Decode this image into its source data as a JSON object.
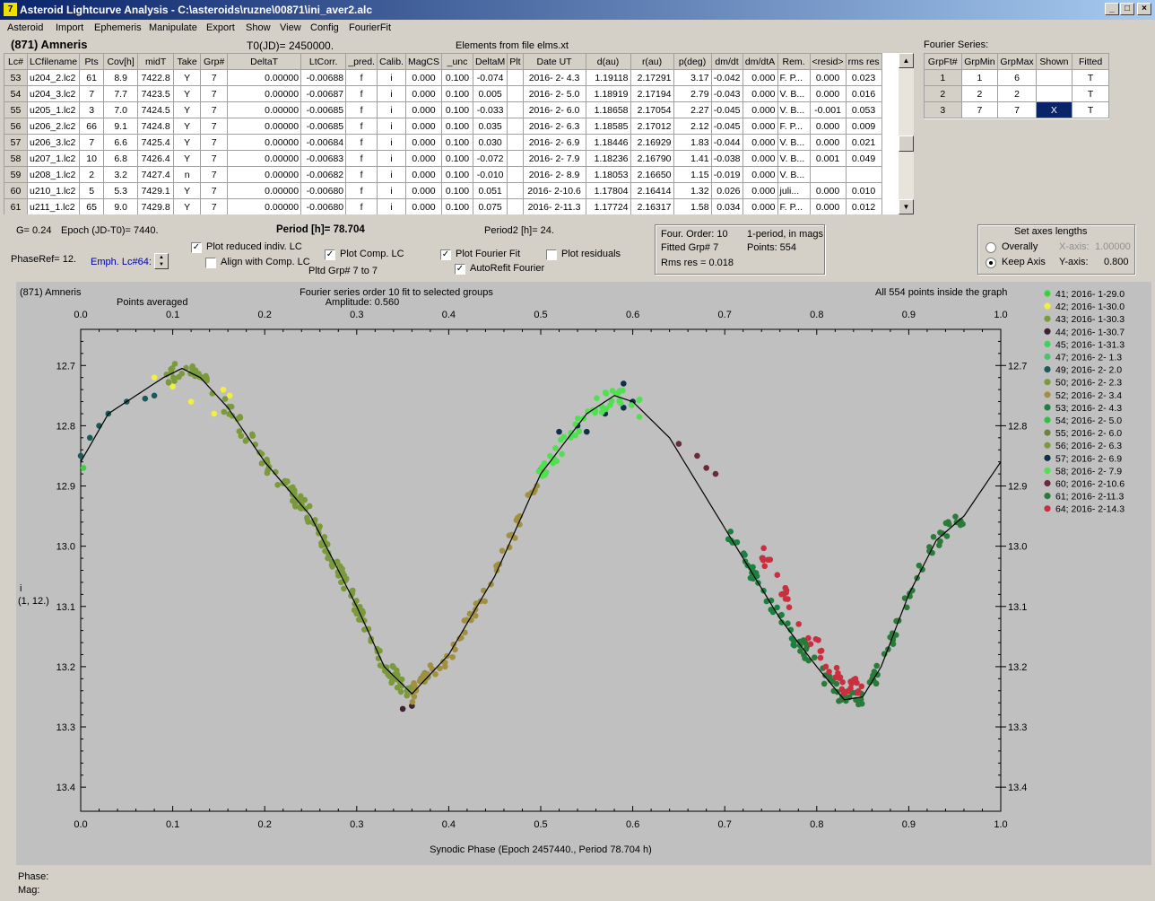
{
  "window": {
    "title": "Asteroid Lightcurve Analysis - C:\\asteroids\\ruzne\\00871\\ini_aver2.alc",
    "min": "_",
    "max": "□",
    "close": "×"
  },
  "menu": [
    "Asteroid",
    "Import",
    "Ephemeris",
    "Manipulate",
    "Export",
    "Show",
    "View",
    "Config",
    "FourierFit"
  ],
  "header": {
    "asteroid": "(871) Amneris",
    "t0": "T0(JD)= 2450000.",
    "elements": "Elements from file elms.xt",
    "fourier_title": "Fourier Series:"
  },
  "table": {
    "columns": [
      "Lc#",
      "LCfilename",
      "Pts",
      "Cov[h]",
      "midT",
      "Take",
      "Grp#",
      "DeltaT",
      "LtCorr.",
      "_pred.",
      "Calib.",
      "MagCS",
      "_unc",
      "DeltaM",
      "Plt",
      "Date UT",
      "d(au)",
      "r(au)",
      "p(deg)",
      "dm/dt",
      "dm/dtA",
      "Rem.",
      "<resid>",
      "rms res"
    ],
    "rows": [
      [
        "53",
        "u204_2.lc2",
        "61",
        "8.9",
        "7422.8",
        "Y",
        "7",
        "0.00000",
        "-0.00688",
        "f",
        "i",
        "0.000",
        "0.100",
        "-0.074",
        "",
        "2016- 2- 4.3",
        "1.19118",
        "2.17291",
        "3.17",
        "-0.042",
        "0.000",
        "F. P...",
        "0.000",
        "0.023"
      ],
      [
        "54",
        "u204_3.lc2",
        "7",
        "7.7",
        "7423.5",
        "Y",
        "7",
        "0.00000",
        "-0.00687",
        "f",
        "i",
        "0.000",
        "0.100",
        "0.005",
        "",
        "2016- 2- 5.0",
        "1.18919",
        "2.17194",
        "2.79",
        "-0.043",
        "0.000",
        "V. B...",
        "0.000",
        "0.016"
      ],
      [
        "55",
        "u205_1.lc2",
        "3",
        "7.0",
        "7424.5",
        "Y",
        "7",
        "0.00000",
        "-0.00685",
        "f",
        "i",
        "0.000",
        "0.100",
        "-0.033",
        "",
        "2016- 2- 6.0",
        "1.18658",
        "2.17054",
        "2.27",
        "-0.045",
        "0.000",
        "V. B...",
        "-0.001",
        "0.053"
      ],
      [
        "56",
        "u206_2.lc2",
        "66",
        "9.1",
        "7424.8",
        "Y",
        "7",
        "0.00000",
        "-0.00685",
        "f",
        "i",
        "0.000",
        "0.100",
        "0.035",
        "",
        "2016- 2- 6.3",
        "1.18585",
        "2.17012",
        "2.12",
        "-0.045",
        "0.000",
        "F. P...",
        "0.000",
        "0.009"
      ],
      [
        "57",
        "u206_3.lc2",
        "7",
        "6.6",
        "7425.4",
        "Y",
        "7",
        "0.00000",
        "-0.00684",
        "f",
        "i",
        "0.000",
        "0.100",
        "0.030",
        "",
        "2016- 2- 6.9",
        "1.18446",
        "2.16929",
        "1.83",
        "-0.044",
        "0.000",
        "V. B...",
        "0.000",
        "0.021"
      ],
      [
        "58",
        "u207_1.lc2",
        "10",
        "6.8",
        "7426.4",
        "Y",
        "7",
        "0.00000",
        "-0.00683",
        "f",
        "i",
        "0.000",
        "0.100",
        "-0.072",
        "",
        "2016- 2- 7.9",
        "1.18236",
        "2.16790",
        "1.41",
        "-0.038",
        "0.000",
        "V. B...",
        "0.001",
        "0.049"
      ],
      [
        "59",
        "u208_1.lc2",
        "2",
        "3.2",
        "7427.4",
        "n",
        "7",
        "0.00000",
        "-0.00682",
        "f",
        "i",
        "0.000",
        "0.100",
        "-0.010",
        "",
        "2016- 2- 8.9",
        "1.18053",
        "2.16650",
        "1.15",
        "-0.019",
        "0.000",
        "V. B...",
        "",
        ""
      ],
      [
        "60",
        "u210_1.lc2",
        "5",
        "5.3",
        "7429.1",
        "Y",
        "7",
        "0.00000",
        "-0.00680",
        "f",
        "i",
        "0.000",
        "0.100",
        "0.051",
        "",
        "2016- 2-10.6",
        "1.17804",
        "2.16414",
        "1.32",
        "0.026",
        "0.000",
        "juli...",
        "0.000",
        "0.010"
      ],
      [
        "61",
        "u211_1.lc2",
        "65",
        "9.0",
        "7429.8",
        "Y",
        "7",
        "0.00000",
        "-0.00680",
        "f",
        "i",
        "0.000",
        "0.100",
        "0.075",
        "",
        "2016- 2-11.3",
        "1.17724",
        "2.16317",
        "1.58",
        "0.034",
        "0.000",
        "F. P...",
        "0.000",
        "0.012"
      ]
    ]
  },
  "fourier_table": {
    "columns": [
      "GrpFt#",
      "GrpMin",
      "GrpMax",
      "Shown",
      "Fitted"
    ],
    "rows": [
      [
        "1",
        "1",
        "6",
        "",
        "T"
      ],
      [
        "2",
        "2",
        "2",
        "",
        "T"
      ],
      [
        "3",
        "7",
        "7",
        "X",
        "T"
      ]
    ]
  },
  "controls": {
    "g": "G= 0.24",
    "epoch": "Epoch (JD-T0)= 7440.",
    "period": "Period [h]= 78.704",
    "period2": "Period2 [h]= 24.",
    "phaseref": "PhaseRef= 12.",
    "emph": "Emph. Lc#64:",
    "plot_reduced": "Plot reduced indiv. LC",
    "align": "Align with Comp. LC",
    "plot_comp": "Plot Comp. LC",
    "pltd_grp": "Pltd Grp#  7   to   7",
    "plot_fourier": "Plot Fourier Fit",
    "autorefit": "AutoRefit Fourier",
    "plot_resid": "Plot residuals",
    "four_order": "Four. Order: 10",
    "one_period": "1-period, in mags",
    "fitted_grp": "Fitted Grp# 7",
    "points": "Points: 554",
    "rms": "Rms res      = 0.018",
    "axes_title": "Set axes lengths",
    "overally": "Overally",
    "keep_axis": "Keep Axis",
    "xaxis_lbl": "X-axis:",
    "xaxis_val": "1.00000",
    "yaxis_lbl": "Y-axis:",
    "yaxis_val": "0.800"
  },
  "plot": {
    "name": "(871) Amneris",
    "averaged": "Points averaged",
    "subtitle": "Fourier series order 10 fit to selected groups",
    "amplitude": "Amplitude: 0.560",
    "inside": "All 554 points inside the graph",
    "ylabel": "i",
    "ylabel2": "(1, 12.)",
    "xlabel": "Synodic Phase (Epoch 2457440., Period 78.704 h)"
  },
  "status": {
    "phase": "Phase:",
    "mag": "Mag:"
  },
  "chart_data": {
    "type": "scatter",
    "xlim": [
      0,
      1
    ],
    "ylim": [
      12.64,
      13.44
    ],
    "y_inverted": true,
    "xticks": [
      "0.0",
      "0.1",
      "0.2",
      "0.3",
      "0.4",
      "0.5",
      "0.6",
      "0.7",
      "0.8",
      "0.9",
      "1.0"
    ],
    "yticks": [
      "12.7",
      "12.8",
      "12.9",
      "13.0",
      "13.1",
      "13.2",
      "13.3",
      "13.4"
    ],
    "fourier_fit": {
      "x": [
        0,
        0.03,
        0.06,
        0.09,
        0.11,
        0.13,
        0.16,
        0.2,
        0.25,
        0.3,
        0.33,
        0.36,
        0.4,
        0.45,
        0.5,
        0.55,
        0.58,
        0.6,
        0.64,
        0.68,
        0.72,
        0.76,
        0.8,
        0.83,
        0.85,
        0.87,
        0.9,
        0.93,
        0.96,
        1.0
      ],
      "y": [
        12.86,
        12.78,
        12.75,
        12.72,
        12.705,
        12.72,
        12.77,
        12.86,
        12.95,
        13.1,
        13.2,
        13.245,
        13.18,
        13.05,
        12.88,
        12.78,
        12.75,
        12.76,
        12.82,
        12.92,
        13.02,
        13.12,
        13.2,
        13.255,
        13.25,
        13.2,
        13.08,
        12.99,
        12.95,
        12.86
      ]
    },
    "series": [
      {
        "name": "41; 2016- 1-29.0",
        "color": "#3cd03c",
        "points": [
          [
            0.003,
            12.87
          ]
        ]
      },
      {
        "name": "42; 2016- 1-30.0",
        "color": "#f0f040",
        "points": [
          [
            0.08,
            12.72
          ],
          [
            0.1,
            12.735
          ],
          [
            0.12,
            12.76
          ],
          [
            0.145,
            12.78
          ],
          [
            0.155,
            12.74
          ],
          [
            0.162,
            12.75
          ]
        ]
      },
      {
        "name": "43; 2016- 1-30.3",
        "color": "#7a9a3c",
        "segments": [
          [
            0.09,
            0.16,
            12.7,
            12.72
          ],
          [
            0.16,
            0.32,
            12.74,
            13.05
          ],
          [
            0.32,
            0.38,
            13.1,
            13.24
          ]
        ]
      },
      {
        "name": "44; 2016- 1-30.7",
        "color": "#402030",
        "points": [
          [
            0.35,
            13.27
          ],
          [
            0.36,
            13.265
          ]
        ]
      },
      {
        "name": "45; 2016- 1-31.3",
        "color": "#40d060",
        "points": []
      },
      {
        "name": "47; 2016- 2- 1.3",
        "color": "#50c070",
        "points": []
      },
      {
        "name": "49; 2016- 2- 2.0",
        "color": "#1c5a5a",
        "points": [
          [
            0.0,
            12.85
          ],
          [
            0.01,
            12.82
          ],
          [
            0.02,
            12.8
          ],
          [
            0.03,
            12.78
          ],
          [
            0.05,
            12.76
          ],
          [
            0.07,
            12.755
          ],
          [
            0.08,
            12.75
          ]
        ]
      },
      {
        "name": "50; 2016- 2- 2.3",
        "color": "#7a9a3c",
        "segments": [
          [
            0.22,
            0.36,
            12.95,
            13.24
          ]
        ]
      },
      {
        "name": "52; 2016- 2- 3.4",
        "color": "#a09040",
        "segments": [
          [
            0.36,
            0.51,
            13.23,
            12.86
          ]
        ]
      },
      {
        "name": "53; 2016- 2- 4.3",
        "color": "#1c8040",
        "segments": [
          [
            0.7,
            0.79,
            12.9,
            13.1
          ]
        ]
      },
      {
        "name": "54; 2016- 2- 5.0",
        "color": "#30c040",
        "points": []
      },
      {
        "name": "55; 2016- 2- 6.0",
        "color": "#708040",
        "points": []
      },
      {
        "name": "56; 2016- 2- 6.3",
        "color": "#7a9a3c",
        "points": []
      },
      {
        "name": "57; 2016- 2- 6.9",
        "color": "#10304a",
        "points": [
          [
            0.52,
            12.81
          ],
          [
            0.54,
            12.8
          ],
          [
            0.55,
            12.81
          ],
          [
            0.57,
            12.78
          ],
          [
            0.59,
            12.77
          ],
          [
            0.6,
            12.76
          ],
          [
            0.59,
            12.73
          ]
        ]
      },
      {
        "name": "58; 2016- 2- 7.9",
        "color": "#50e050",
        "segments": [
          [
            0.49,
            0.61,
            12.92,
            12.76
          ]
        ]
      },
      {
        "name": "60; 2016- 2-10.6",
        "color": "#6a2a38",
        "points": [
          [
            0.65,
            12.83
          ],
          [
            0.67,
            12.85
          ],
          [
            0.68,
            12.87
          ],
          [
            0.69,
            12.88
          ]
        ]
      },
      {
        "name": "61; 2016- 2-11.3",
        "color": "#2a7a3a",
        "segments": [
          [
            0.78,
            0.84,
            13.1,
            13.28
          ],
          [
            0.84,
            0.93,
            13.26,
            13.0
          ],
          [
            0.93,
            0.96,
            12.99,
            12.98
          ]
        ]
      },
      {
        "name": "64; 2016- 2-14.3",
        "color": "#c83040",
        "segments": [
          [
            0.74,
            0.85,
            12.96,
            13.3
          ]
        ]
      }
    ]
  }
}
